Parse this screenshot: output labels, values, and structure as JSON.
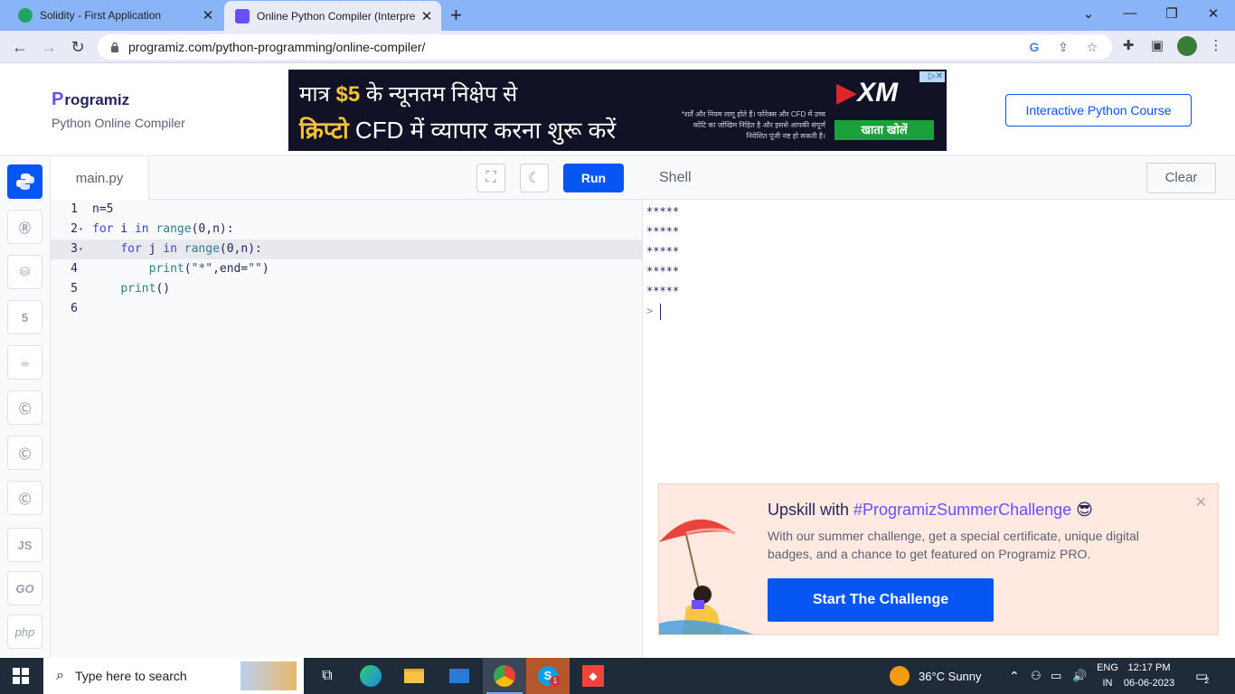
{
  "browser": {
    "tabs": [
      {
        "title": "Solidity - First Application",
        "favicon_color": "#21a366"
      },
      {
        "title": "Online Python Compiler (Interpre",
        "favicon_color": "#6b4fff"
      }
    ],
    "url": "programiz.com/python-programming/online-compiler/"
  },
  "header": {
    "brand_name": "rogramiz",
    "brand_initial": "P",
    "subtitle": "Python Online Compiler",
    "course_button": "Interactive Python Course"
  },
  "ad": {
    "line1_pre": "मात्र ",
    "line1_amount": "$5",
    "line1_post": " के न्यूनतम निक्षेप से",
    "line2_bold": "क्रिप्टो",
    "line2_rest": " CFD में व्यापार करना शुरू करें",
    "fine_print": "*शर्तें और नियम लागू होते हैं। फोरेक्स और CFD में उच्च कोटि का जोखिम निहित है और इससे आपकी संपूर्ण निवेशित पूंजी नष्ट हो सकती है।",
    "brand": "XM",
    "cta": "खाता खोलें"
  },
  "rail": {
    "languages": [
      "Python",
      "R",
      "SQL",
      "HTML",
      "Java",
      "C",
      "C++",
      "C#",
      "JS",
      "GO",
      "php"
    ]
  },
  "editor": {
    "filename": "main.py",
    "run_label": "Run",
    "lines": [
      {
        "n": "1",
        "fold": "",
        "html": "n=5"
      },
      {
        "n": "2",
        "fold": "▾",
        "html": "<span class='kw'>for</span> i <span class='kw'>in</span> <span class='fn'>range</span>(0,n):"
      },
      {
        "n": "3",
        "fold": "▾",
        "html": "    <span class='kw'>for</span> j <span class='kw'>in</span> <span class='fn'>range</span>(0,n):"
      },
      {
        "n": "4",
        "fold": "",
        "html": "        <span class='fn'>print</span>(<span class='str'>\"*\"</span>,end=<span class='str'>\"\"</span>)"
      },
      {
        "n": "5",
        "fold": "",
        "html": "    <span class='fn'>print</span>()"
      },
      {
        "n": "6",
        "fold": "",
        "html": ""
      }
    ],
    "highlight_line": 3
  },
  "shell": {
    "title": "Shell",
    "clear_label": "Clear",
    "output": [
      "*****",
      "*****",
      "*****",
      "*****",
      "*****"
    ],
    "prompt": ">"
  },
  "promo": {
    "title_pre": "Upskill with ",
    "title_tag": "#ProgramizSummerChallenge",
    "title_emoji": "😎",
    "description": "With our summer challenge, get a special certificate, unique digital badges, and a chance to get featured on Programiz PRO.",
    "cta": "Start The Challenge"
  },
  "taskbar": {
    "search_placeholder": "Type here to search",
    "weather": "36°C  Sunny",
    "lang_line1": "ENG",
    "lang_line2": "IN",
    "time": "12:17 PM",
    "date": "06-06-2023",
    "notif_count": "2",
    "skype_badge": "1"
  }
}
